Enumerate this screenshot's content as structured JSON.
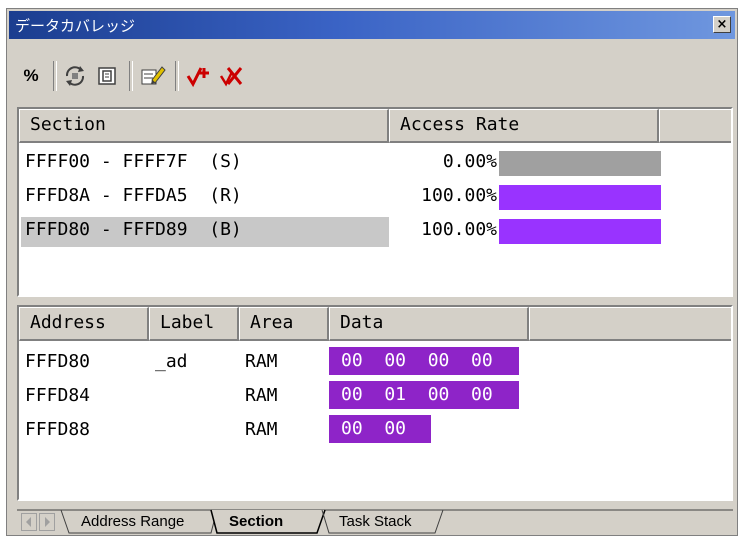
{
  "window": {
    "title": "データカバレッジ",
    "close_glyph": "×"
  },
  "toolbar": {
    "percent_label": "%",
    "colors": {
      "add_red": "#cc0000"
    }
  },
  "section_table": {
    "headers": [
      "Section",
      "Access Rate"
    ],
    "rows": [
      {
        "range": "FFFF00 - FFFF7F  (S)",
        "rate": "0.00%",
        "rate_value": 0.0,
        "bar_color": "#a0a0a0",
        "selected": false
      },
      {
        "range": "FFFD8A - FFFDA5  (R)",
        "rate": "100.00%",
        "rate_value": 100.0,
        "bar_color": "#9933ff",
        "selected": false
      },
      {
        "range": "FFFD80 - FFFD89  (B)",
        "rate": "100.00%",
        "rate_value": 100.0,
        "bar_color": "#9933ff",
        "selected": true
      }
    ]
  },
  "data_table": {
    "headers": [
      "Address",
      "Label",
      "Area",
      "Data"
    ],
    "rows": [
      {
        "address": "FFFD80",
        "label": "_ad",
        "area": "RAM",
        "data": "00  00  00  00"
      },
      {
        "address": "FFFD84",
        "label": "",
        "area": "RAM",
        "data": "00  01  00  00"
      },
      {
        "address": "FFFD88",
        "label": "",
        "area": "RAM",
        "data": "00  00"
      }
    ],
    "data_color": "#8e24c8"
  },
  "tabs": [
    {
      "label": "Address Range",
      "active": false
    },
    {
      "label": "Section",
      "active": true
    },
    {
      "label": "Task Stack",
      "active": false
    }
  ]
}
